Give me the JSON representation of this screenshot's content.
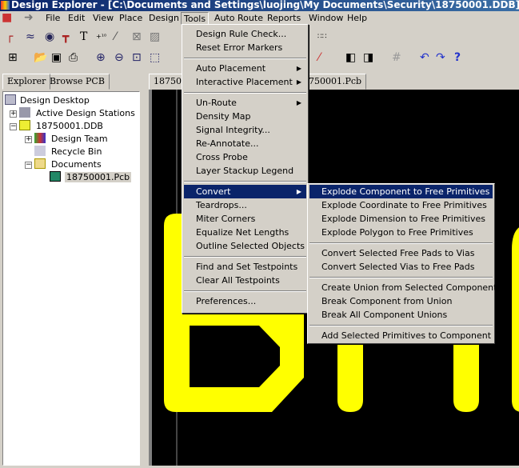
{
  "title": "Design Explorer - [C:\\Documents and Settings\\luojing\\My Documents\\Security\\18750001.DDB]",
  "menubar": [
    "File",
    "Edit",
    "View",
    "Place",
    "Design",
    "Tools",
    "Auto Route",
    "Reports",
    "Window",
    "Help"
  ],
  "panel_tabs": [
    "Explorer",
    "Browse PCB"
  ],
  "tree": [
    "Design Desktop",
    "Active Design Stations",
    "18750001.DDB",
    "Design Team",
    "Recycle Bin",
    "Documents",
    "18750001.Pcb"
  ],
  "doc_tabs": [
    "18750",
    "750001.Pcb"
  ],
  "tools_menu": [
    "Design Rule Check...",
    "Reset Error Markers",
    "Auto Placement",
    "Interactive Placement",
    "Un-Route",
    "Density Map",
    "Signal Integrity...",
    "Re-Annotate...",
    "Cross Probe",
    "Layer Stackup Legend",
    "Convert",
    "Teardrops...",
    "Miter Corners",
    "Equalize Net Lengths",
    "Outline Selected Objects",
    "Find and Set Testpoints",
    "Clear All Testpoints",
    "Preferences..."
  ],
  "convert_menu": [
    "Explode Component to Free Primitives",
    "Explode Coordinate to Free Primitives",
    "Explode Dimension to Free Primitives",
    "Explode Polygon to Free Primitives",
    "Convert Selected Free Pads to Vias",
    "Convert Selected Vias to Free Pads",
    "Create Union from Selected Components",
    "Break Component from Union",
    "Break All Component Unions",
    "Add Selected Primitives to Component"
  ],
  "colors": {
    "track": "#ffff00",
    "board": "#000000",
    "selection": "#0a246a"
  }
}
